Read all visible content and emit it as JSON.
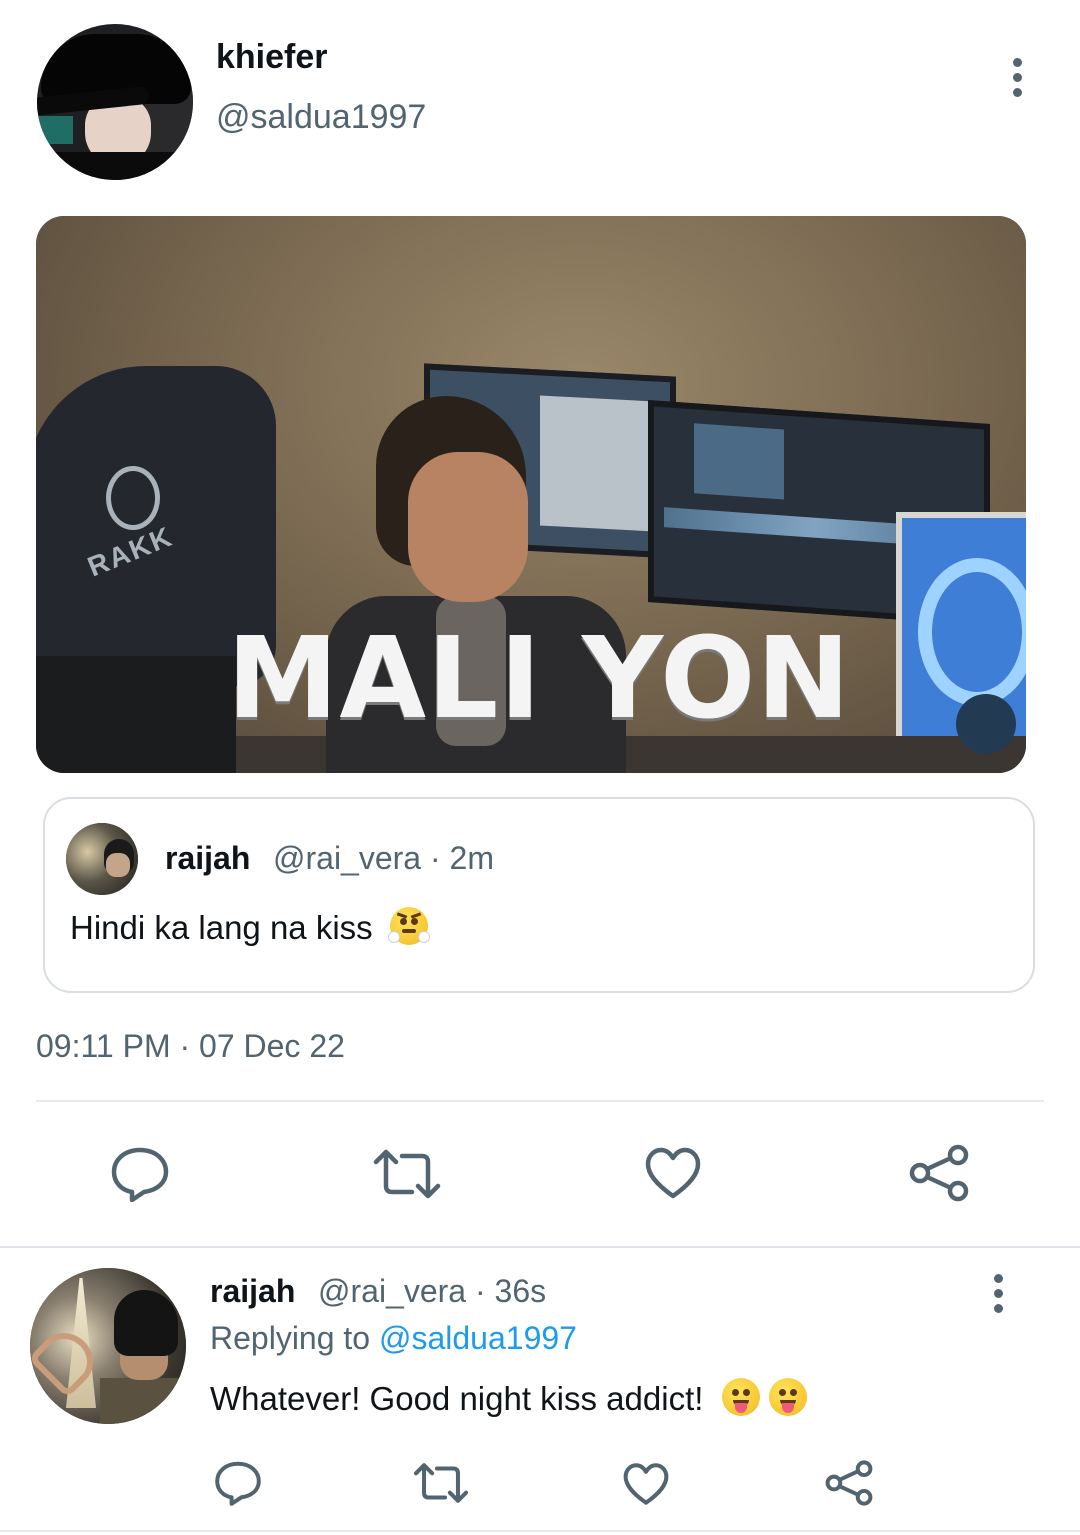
{
  "tweet": {
    "author": {
      "display_name": "khiefer",
      "handle": "@saldua1997"
    },
    "media": {
      "caption": "MALI YON",
      "cap_text": "RAKK"
    },
    "quote": {
      "display_name": "raijah",
      "handle_time": "@rai_vera · 2m",
      "text": "Hindi ka lang na kiss",
      "emoji": "face-with-steam-from-nose"
    },
    "timestamp": "09:11 PM · 07 Dec 22",
    "actions": [
      "reply-icon",
      "retweet-icon",
      "like-icon",
      "share-icon"
    ]
  },
  "reply": {
    "display_name": "raijah",
    "handle_time": "@rai_vera · 36s",
    "replying_prefix": "Replying to ",
    "replying_mention": "@saldua1997",
    "text": "Whatever! Good night kiss addict! ",
    "emojis": [
      "face-with-tongue",
      "face-with-tongue"
    ],
    "actions": [
      "reply-icon",
      "retweet-icon",
      "like-icon",
      "share-icon"
    ]
  },
  "colors": {
    "text_primary": "#0f1419",
    "text_secondary": "#536471",
    "link": "#1d9bf0",
    "icon": "#536471",
    "divider": "#e7eaed"
  }
}
